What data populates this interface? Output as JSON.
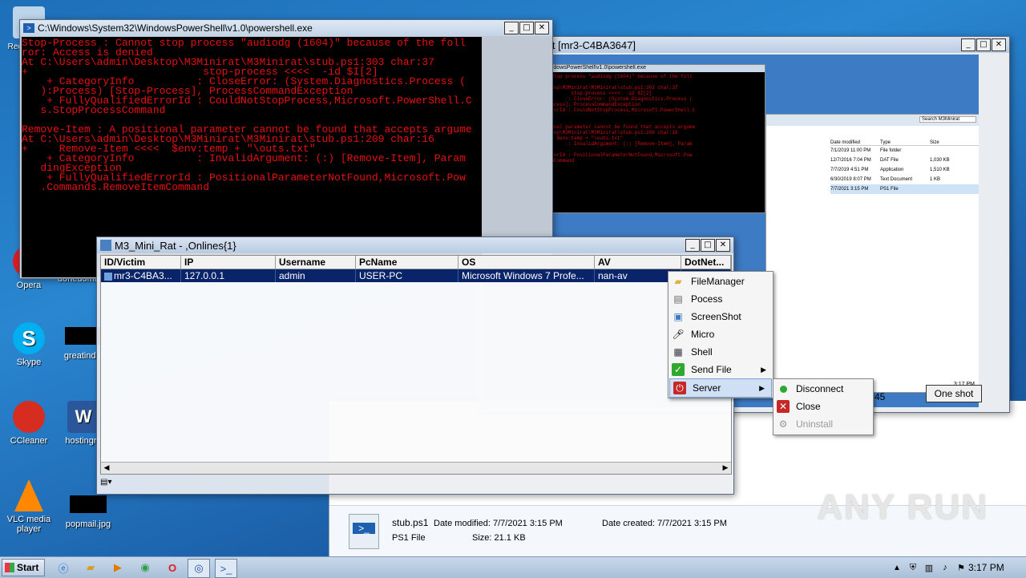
{
  "desktop": {
    "icons": [
      {
        "label": "Recycle Bin",
        "color": "#d9e6f2"
      },
      {
        "label": "Opera",
        "color": "#e01b22"
      },
      {
        "label": "donedomain.jpg",
        "color": "#000000"
      },
      {
        "label": "Skype",
        "color": "#00aff0"
      },
      {
        "label": "greatindia",
        "color": "#000000"
      },
      {
        "label": "CCleaner",
        "color": "#d62d20"
      },
      {
        "label": "hostingre",
        "color": "#2b579a"
      },
      {
        "label": "VLC media player",
        "color": "#ff8800"
      },
      {
        "label": "popmail.jpg",
        "color": "#000000"
      }
    ],
    "watermark": "ANY RUN"
  },
  "powershell_main": {
    "title": "C:\\Windows\\System32\\WindowsPowerShell\\v1.0\\powershell.exe",
    "lines": [
      "Stop-Process : Cannot stop process \"audiodg (1604)\" because of the foll",
      "ror: Access is denied",
      "At C:\\Users\\admin\\Desktop\\M3Minirat\\M3Minirat\\stub.ps1:303 char:37",
      "+                            stop-process <<<<  -id $I[2]",
      "    + CategoryInfo          : CloseError: (System.Diagnostics.Process (",
      "   ):Process) [Stop-Process], ProcessCommandException",
      "    + FullyQualifiedErrorId : CouldNotStopProcess,Microsoft.PowerShell.C",
      "   s.StopProcessCommand",
      "",
      "Remove-Item : A positional parameter cannot be found that accepts argume",
      "At C:\\Users\\admin\\Desktop\\M3Minirat\\M3Minirat\\stub.ps1:209 char:16",
      "+     Remove-Item <<<<  $env:temp + \"\\outs.txt\"",
      "    + CategoryInfo          : InvalidArgument: (:) [Remove-Item], Param",
      "   dingException",
      "    + FullyQualifiedErrorId : PositionalParameterNotFound,Microsoft.Pow",
      "   .Commands.RemoveItemCommand"
    ]
  },
  "screenshot_window": {
    "title": "Screen Shot [mr3-C4BA3647]",
    "button": "One shot",
    "partial_value": "45",
    "inner_title": "C:\\Windows\\System32\\WindowsPowerShell\\v1.0\\powershell.exe",
    "inner_search": "Search M3Minirat",
    "inner_columns": [
      "Date modified",
      "Type",
      "Size"
    ],
    "inner_rows": [
      [
        "7/1/2019 11:00 PM",
        "File folder",
        ""
      ],
      [
        "12/7/2016 7:04 PM",
        "DAT File",
        "1,030 KB"
      ],
      [
        "7/7/2019 4:51 PM",
        "Application",
        "1,510 KB"
      ],
      [
        "6/30/2019 8:07 PM",
        "Text Document",
        "1 KB"
      ],
      [
        "7/7/2021 3:15 PM",
        "PS1 File",
        ""
      ]
    ],
    "inner_clock": "3:17 PM"
  },
  "rat_window": {
    "title": "M3_Mini_Rat - ,Onlines{1}",
    "columns": [
      "ID/Victim",
      "IP",
      "Username",
      "PcName",
      "OS",
      "AV",
      "DotNet..."
    ],
    "rows": [
      [
        "mr3-C4BA3...",
        "127.0.0.1",
        "admin",
        "USER-PC",
        "Microsoft Windows 7 Profe...",
        "nan-av",
        ""
      ]
    ]
  },
  "context_menu": {
    "items": [
      {
        "label": "FileManager",
        "icon": "folder-icon"
      },
      {
        "label": "Pocess",
        "icon": "process-icon"
      },
      {
        "label": "ScreenShot",
        "icon": "screenshot-icon"
      },
      {
        "label": "Micro",
        "icon": "microphone-icon"
      },
      {
        "label": "Shell",
        "icon": "shell-icon"
      },
      {
        "label": "Send File",
        "icon": "check-icon"
      },
      {
        "label": "Server",
        "icon": "power-icon"
      }
    ],
    "submenu": [
      {
        "label": "Disconnect",
        "icon": "green-dot-icon"
      },
      {
        "label": "Close",
        "icon": "red-x-icon"
      },
      {
        "label": "Uninstall",
        "icon": "gear-icon"
      }
    ]
  },
  "explorer_details": {
    "filename": "stub.ps1",
    "date_modified": "Date modified: 7/7/2021 3:15 PM",
    "date_created": "Date created: 7/7/2021 3:15 PM",
    "file_type": "PS1 File",
    "size": "Size: 21.1 KB"
  },
  "taskbar": {
    "start": "Start",
    "clock": "3:17 PM"
  }
}
